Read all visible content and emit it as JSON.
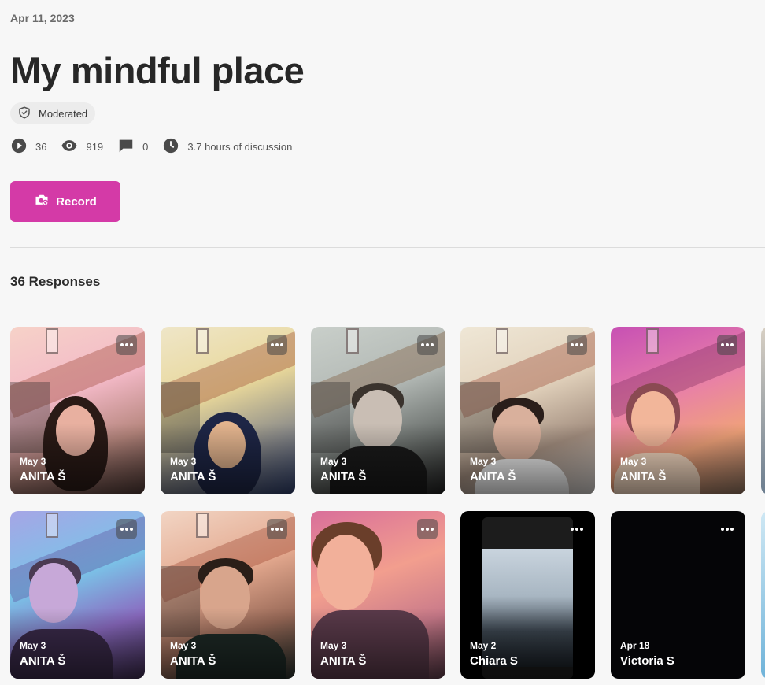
{
  "header": {
    "date": "Apr 11, 2023",
    "title": "My mindful place",
    "badge": "Moderated"
  },
  "stats": {
    "videos": "36",
    "views": "919",
    "comments": "0",
    "duration": "3.7 hours of discussion"
  },
  "record_button": "Record",
  "responses_heading": "36 Responses",
  "colors": {
    "accent": "#d43aa7",
    "background": "#f7f7f7"
  },
  "cards": [
    {
      "date": "May 3",
      "name": "ANITA Š"
    },
    {
      "date": "May 3",
      "name": "ANITA Š"
    },
    {
      "date": "May 3",
      "name": "ANITA Š"
    },
    {
      "date": "May 3",
      "name": "ANITA Š"
    },
    {
      "date": "May 3",
      "name": "ANITA Š"
    },
    {
      "date": "May 3",
      "name": "ANITA Š"
    },
    {
      "date": "May 3",
      "name": "ANITA Š"
    },
    {
      "date": "May 3",
      "name": "ANITA Š"
    },
    {
      "date": "May 2",
      "name": "Chiara S"
    },
    {
      "date": "Apr 18",
      "name": "Victoria S"
    }
  ]
}
